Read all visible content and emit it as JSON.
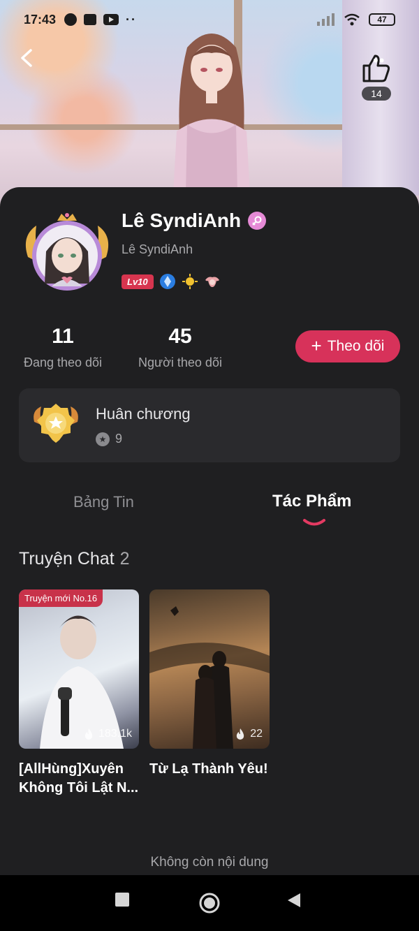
{
  "status_bar": {
    "time": "17:43",
    "battery": "47"
  },
  "header": {
    "like_count": "14",
    "more": "••"
  },
  "profile": {
    "name": "Lê SyndiAnh",
    "handle": "Lê SyndiAnh",
    "level": "Lv10"
  },
  "stats": {
    "following_count": "11",
    "following_label": "Đang theo dõi",
    "followers_count": "45",
    "followers_label": "Người theo dõi"
  },
  "follow_button": {
    "label": "Theo dõi",
    "plus": "+"
  },
  "medal": {
    "title": "Huân chương",
    "count": "9"
  },
  "tabs": [
    {
      "label": "Bảng Tin",
      "active": false
    },
    {
      "label": "Tác Phẩm",
      "active": true
    }
  ],
  "section": {
    "title": "Truyện Chat",
    "count": "2"
  },
  "stories": [
    {
      "tag": "Truyện mới No.16",
      "views": "183.1k",
      "title_line1": "[AllHùng]Xuyên",
      "title_line2": "Không Tôi Lật N..."
    },
    {
      "tag": "",
      "views": "22",
      "title_line1": "Từ Lạ Thành Yêu!",
      "title_line2": ""
    }
  ],
  "footer": {
    "end_text": "Không còn nội dung"
  },
  "colors": {
    "accent": "#d7325a",
    "background": "#1f1f21",
    "card": "#2a2a2d",
    "muted": "#a8a8ab"
  }
}
